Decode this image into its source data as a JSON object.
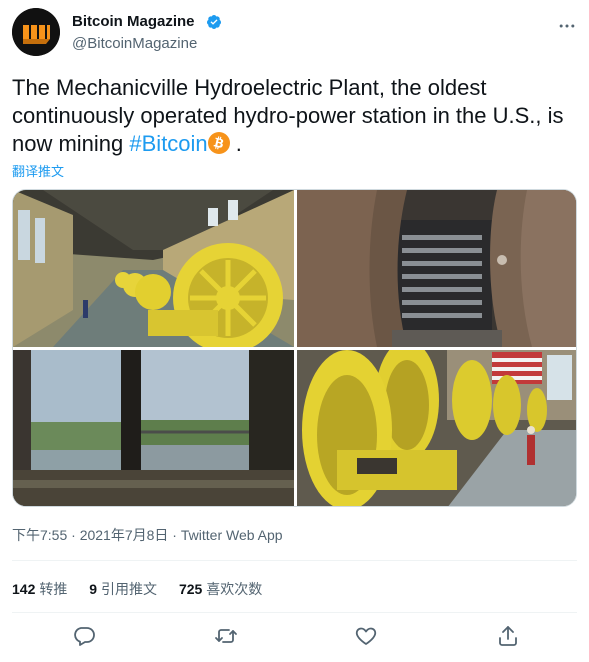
{
  "author": {
    "display_name": "Bitcoin Magazine",
    "handle": "@BitcoinMagazine",
    "verified": true,
    "avatar_icon": "bitcoin-magazine-logo-icon"
  },
  "tweet": {
    "text_before": "The Mechanicville Hydroelectric Plant, the oldest continuously operated hydro-power station in the U.S., is now mining ",
    "hashtag": "#Bitcoin",
    "text_after": " .",
    "emoji": "bitcoin-emoji-icon",
    "translate_label": "翻译推文"
  },
  "media": {
    "count": 4,
    "icons": [
      "powerhouse-generators-photo",
      "mining-rigs-photo",
      "river-window-view-photo",
      "yellow-turbines-photo"
    ]
  },
  "meta": {
    "time": "下午7:55",
    "separator": " · ",
    "date": "2021年7月8日",
    "source": "Twitter Web App"
  },
  "stats": {
    "retweets": "142",
    "retweets_label": "转推",
    "quotes": "9",
    "quotes_label": "引用推文",
    "likes": "725",
    "likes_label": "喜欢次数"
  },
  "colors": {
    "link": "#1d9bf0",
    "secondary_text": "#536471",
    "primary_text": "#0f1419",
    "verified": "#1d9bf0",
    "bitcoin_orange": "#f7931a"
  }
}
